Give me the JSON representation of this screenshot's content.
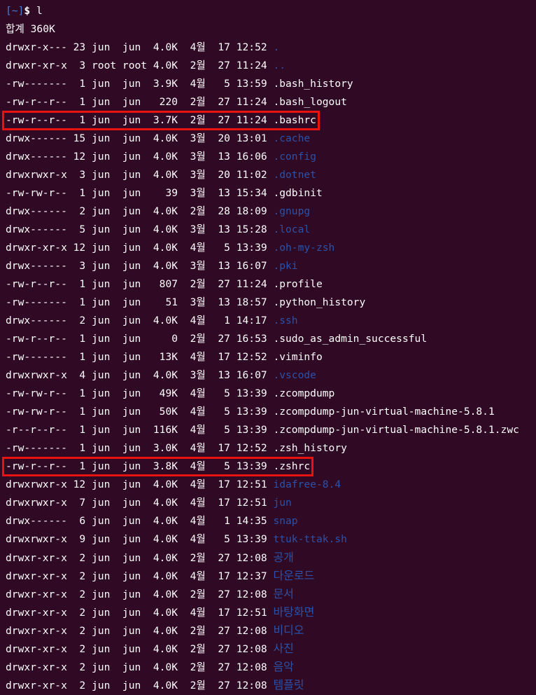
{
  "prompt": {
    "open_bracket": "[",
    "path": "~",
    "close_bracket": "]",
    "dollar": "$",
    "command": "l"
  },
  "total": "합계 360K",
  "listing": [
    {
      "meta": "drwxr-x--- 23 jun  jun  4.0K  4월  17 12:52 ",
      "name": ".",
      "type": "dir"
    },
    {
      "meta": "drwxr-xr-x  3 root root 4.0K  2월  27 11:24 ",
      "name": "..",
      "type": "dir"
    },
    {
      "meta": "-rw-------  1 jun  jun  3.9K  4월   5 13:59 ",
      "name": ".bash_history",
      "type": "file"
    },
    {
      "meta": "-rw-r--r--  1 jun  jun   220  2월  27 11:24 ",
      "name": ".bash_logout",
      "type": "file"
    },
    {
      "meta": "-rw-r--r--  1 jun  jun  3.7K  2월  27 11:24 ",
      "name": ".bashrc",
      "type": "file",
      "highlight": true
    },
    {
      "meta": "drwx------ 15 jun  jun  4.0K  3월  20 13:01 ",
      "name": ".cache",
      "type": "dir"
    },
    {
      "meta": "drwx------ 12 jun  jun  4.0K  3월  13 16:06 ",
      "name": ".config",
      "type": "dir"
    },
    {
      "meta": "drwxrwxr-x  3 jun  jun  4.0K  3월  20 11:02 ",
      "name": ".dotnet",
      "type": "dir"
    },
    {
      "meta": "-rw-rw-r--  1 jun  jun    39  3월  13 15:34 ",
      "name": ".gdbinit",
      "type": "file"
    },
    {
      "meta": "drwx------  2 jun  jun  4.0K  2월  28 18:09 ",
      "name": ".gnupg",
      "type": "dir"
    },
    {
      "meta": "drwx------  5 jun  jun  4.0K  3월  13 15:28 ",
      "name": ".local",
      "type": "dir"
    },
    {
      "meta": "drwxr-xr-x 12 jun  jun  4.0K  4월   5 13:39 ",
      "name": ".oh-my-zsh",
      "type": "dir"
    },
    {
      "meta": "drwx------  3 jun  jun  4.0K  3월  13 16:07 ",
      "name": ".pki",
      "type": "dir"
    },
    {
      "meta": "-rw-r--r--  1 jun  jun   807  2월  27 11:24 ",
      "name": ".profile",
      "type": "file"
    },
    {
      "meta": "-rw-------  1 jun  jun    51  3월  13 18:57 ",
      "name": ".python_history",
      "type": "file"
    },
    {
      "meta": "drwx------  2 jun  jun  4.0K  4월   1 14:17 ",
      "name": ".ssh",
      "type": "dir"
    },
    {
      "meta": "-rw-r--r--  1 jun  jun     0  2월  27 16:53 ",
      "name": ".sudo_as_admin_successful",
      "type": "file"
    },
    {
      "meta": "-rw-------  1 jun  jun   13K  4월  17 12:52 ",
      "name": ".viminfo",
      "type": "file"
    },
    {
      "meta": "drwxrwxr-x  4 jun  jun  4.0K  3월  13 16:07 ",
      "name": ".vscode",
      "type": "dir"
    },
    {
      "meta": "-rw-rw-r--  1 jun  jun   49K  4월   5 13:39 ",
      "name": ".zcompdump",
      "type": "file"
    },
    {
      "meta": "-rw-rw-r--  1 jun  jun   50K  4월   5 13:39 ",
      "name": ".zcompdump-jun-virtual-machine-5.8.1",
      "type": "file"
    },
    {
      "meta": "-r--r--r--  1 jun  jun  116K  4월   5 13:39 ",
      "name": ".zcompdump-jun-virtual-machine-5.8.1.zwc",
      "type": "file"
    },
    {
      "meta": "-rw-------  1 jun  jun  3.0K  4월  17 12:52 ",
      "name": ".zsh_history",
      "type": "file"
    },
    {
      "meta": "-rw-r--r--  1 jun  jun  3.8K  4월   5 13:39 ",
      "name": ".zshrc",
      "type": "file",
      "highlight": true
    },
    {
      "meta": "drwxrwxr-x 12 jun  jun  4.0K  4월  17 12:51 ",
      "name": "idafree-8.4",
      "type": "dir"
    },
    {
      "meta": "drwxrwxr-x  7 jun  jun  4.0K  4월  17 12:51 ",
      "name": "jun",
      "type": "dir"
    },
    {
      "meta": "drwx------  6 jun  jun  4.0K  4월   1 14:35 ",
      "name": "snap",
      "type": "dir"
    },
    {
      "meta": "drwxrwxr-x  9 jun  jun  4.0K  4월   5 13:39 ",
      "name": "ttuk-ttak.sh",
      "type": "exec"
    },
    {
      "meta": "drwxr-xr-x  2 jun  jun  4.0K  2월  27 12:08 ",
      "name": "공개",
      "type": "kor"
    },
    {
      "meta": "drwxr-xr-x  2 jun  jun  4.0K  4월  17 12:37 ",
      "name": "다운로드",
      "type": "kor"
    },
    {
      "meta": "drwxr-xr-x  2 jun  jun  4.0K  2월  27 12:08 ",
      "name": "문서",
      "type": "kor"
    },
    {
      "meta": "drwxr-xr-x  2 jun  jun  4.0K  4월  17 12:51 ",
      "name": "바탕화면",
      "type": "kor"
    },
    {
      "meta": "drwxr-xr-x  2 jun  jun  4.0K  2월  27 12:08 ",
      "name": "비디오",
      "type": "kor"
    },
    {
      "meta": "drwxr-xr-x  2 jun  jun  4.0K  2월  27 12:08 ",
      "name": "사진",
      "type": "kor"
    },
    {
      "meta": "drwxr-xr-x  2 jun  jun  4.0K  2월  27 12:08 ",
      "name": "음악",
      "type": "kor"
    },
    {
      "meta": "drwxr-xr-x  2 jun  jun  4.0K  2월  27 12:08 ",
      "name": "템플릿",
      "type": "kor"
    }
  ],
  "colors": {
    "background": "#300a24",
    "text": "#ffffff",
    "directory": "#2b52a8",
    "prompt_path": "#4e7ac7",
    "annotation_box": "#e8130f"
  }
}
